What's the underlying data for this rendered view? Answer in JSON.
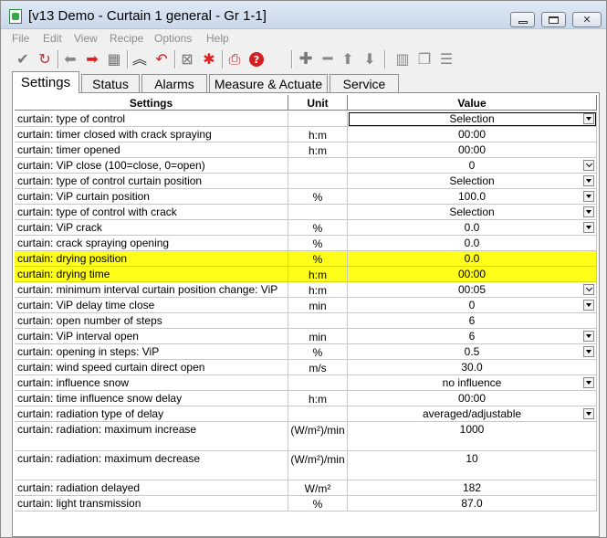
{
  "window": {
    "title": "[v13 Demo - Curtain 1 general - Gr 1-1]",
    "controls": [
      "minimize",
      "maximize",
      "close"
    ]
  },
  "menu": [
    "File",
    "Edit",
    "View",
    "Recipe",
    "Options",
    "Help"
  ],
  "toolbar": {
    "icons": [
      "check-icon",
      "refresh-icon",
      "arrow-left-icon",
      "arrow-right-icon",
      "grid-icon",
      "chevron-up-icon",
      "undo-icon",
      "box-x-icon",
      "asterisk-icon",
      "print-icon",
      "help-icon",
      "plus-icon",
      "minus-icon",
      "arrow-up-icon",
      "arrow-down-icon",
      "columns-icon",
      "copy-icon",
      "list-icon"
    ]
  },
  "tabs": [
    "Settings",
    "Status",
    "Alarms",
    "Measure & Actuate",
    "Service"
  ],
  "grid": {
    "headers": {
      "setting": "Settings",
      "unit": "Unit",
      "value": "Value"
    },
    "rows": [
      {
        "setting": "curtain: type of control",
        "unit": "",
        "value": "Selection",
        "dropdown": "arrow",
        "selected": true
      },
      {
        "setting": "curtain: timer closed with crack spraying",
        "unit": "h:m",
        "value": "00:00"
      },
      {
        "setting": "curtain: timer opened",
        "unit": "h:m",
        "value": "00:00"
      },
      {
        "setting": "curtain: ViP close (100=close, 0=open)",
        "unit": "",
        "value": "0",
        "dropdown": "chevron"
      },
      {
        "setting": "curtain: type of control curtain position",
        "unit": "",
        "value": "Selection",
        "dropdown": "arrow"
      },
      {
        "setting": "curtain: ViP curtain position",
        "unit": "%",
        "value": "100.0",
        "dropdown": "arrow"
      },
      {
        "setting": "curtain: type of control with crack",
        "unit": "",
        "value": "Selection",
        "dropdown": "arrow"
      },
      {
        "setting": "curtain: ViP crack",
        "unit": "%",
        "value": "0.0",
        "dropdown": "arrow"
      },
      {
        "setting": "curtain: crack spraying opening",
        "unit": "%",
        "value": "0.0"
      },
      {
        "setting": "curtain: drying position",
        "unit": "%",
        "value": "0.0",
        "highlight": true
      },
      {
        "setting": "curtain: drying time",
        "unit": "h:m",
        "value": "00:00",
        "highlight": true
      },
      {
        "setting": "curtain: minimum interval curtain position change: ViP",
        "unit": "h:m",
        "value": "00:05",
        "dropdown": "chevron"
      },
      {
        "setting": "curtain: ViP delay time close",
        "unit": "min",
        "value": "0",
        "dropdown": "arrow"
      },
      {
        "setting": "curtain: open number of steps",
        "unit": "",
        "value": "6"
      },
      {
        "setting": "curtain: ViP interval open",
        "unit": "min",
        "value": "6",
        "dropdown": "arrow"
      },
      {
        "setting": "curtain: opening in steps: ViP",
        "unit": "%",
        "value": "0.5",
        "dropdown": "arrow"
      },
      {
        "setting": "curtain: wind speed curtain direct open",
        "unit": "m/s",
        "value": "30.0"
      },
      {
        "setting": "curtain: influence snow",
        "unit": "",
        "value": "no influence",
        "dropdown": "arrow"
      },
      {
        "setting": "curtain: time influence snow delay",
        "unit": "h:m",
        "value": "00:00"
      },
      {
        "setting": "curtain: radiation type of delay",
        "unit": "",
        "value": "averaged/adjustable",
        "dropdown": "arrow"
      },
      {
        "setting": "curtain: radiation: maximum increase",
        "unit": "(W/m²)/min",
        "value": "1000",
        "tall": true
      },
      {
        "setting": "curtain: radiation: maximum decrease",
        "unit": "(W/m²)/min",
        "value": "10",
        "tall": true
      },
      {
        "setting": "curtain: radiation delayed",
        "unit": "W/m²",
        "value": "182"
      },
      {
        "setting": "curtain: light transmission",
        "unit": "%",
        "value": "87.0"
      }
    ]
  },
  "colors": {
    "highlight": "#ffff1a",
    "titlebar": "#c9d8ea"
  }
}
